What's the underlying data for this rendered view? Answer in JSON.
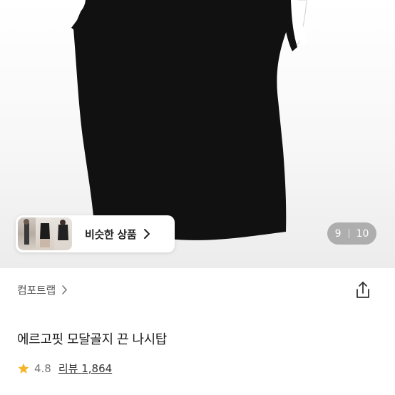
{
  "similar_products": {
    "label": "비슷한 상품"
  },
  "image_pager": {
    "current": "9",
    "total": "10"
  },
  "brand": {
    "name": "컴포트랩"
  },
  "product": {
    "title": "에르고핏 모달골지 끈 나시탑",
    "rating": "4.8",
    "review_label": "리뷰",
    "review_count": "1,864"
  },
  "colors": {
    "star": "#f5b52a",
    "garment": "#111111",
    "trim": "#ffffff"
  },
  "icons": [
    "chevron-right-icon",
    "share-icon",
    "star-icon"
  ]
}
